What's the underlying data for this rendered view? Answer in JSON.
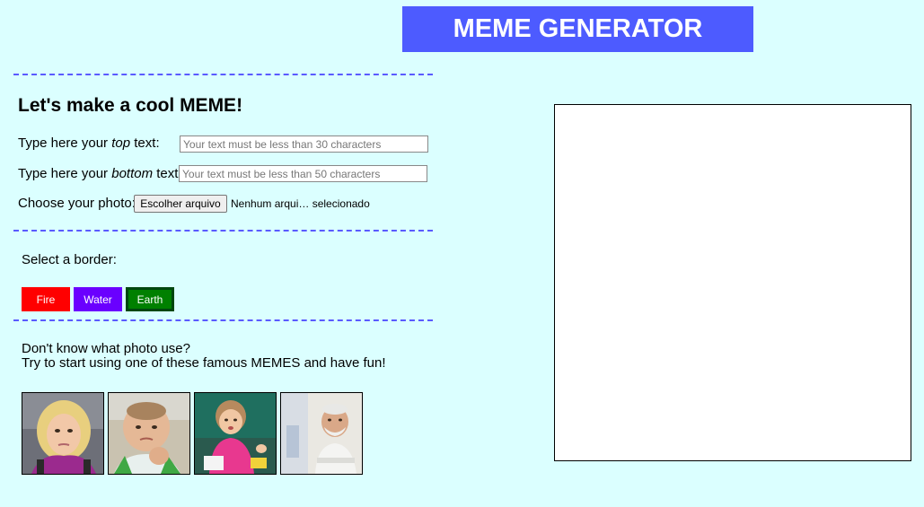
{
  "header": {
    "title": "MEME GENERATOR"
  },
  "form": {
    "heading": "Let's make a cool MEME!",
    "top_label_pre": "Type here your ",
    "top_label_em": "top",
    "top_label_post": " text:",
    "top_placeholder": "Your text must be less than 30 characters",
    "bottom_label_pre": "Type here your ",
    "bottom_label_em": "bottom",
    "bottom_label_post": " text:",
    "bottom_placeholder": "Your text must be less than 50 characters",
    "photo_label": "Choose your photo:",
    "file_button": "Escolher arquivo",
    "file_status": "Nenhum arqui… selecionado"
  },
  "borders": {
    "label": "Select a border:",
    "options": [
      {
        "label": "Fire",
        "color": "#ff0000"
      },
      {
        "label": "Water",
        "color": "#6a00ff"
      },
      {
        "label": "Earth",
        "color": "#008000"
      }
    ]
  },
  "suggestions": {
    "line1": "Don't know what photo use?",
    "line2": "Try to start using one of these famous MEMES and have fun!",
    "thumbnails": [
      "side-eyeing-chloe",
      "success-kid",
      "disaster-girl",
      "hide-the-pain-harold"
    ]
  },
  "colors": {
    "background": "#dbffff",
    "title_bar": "#4d5bff",
    "divider": "#5a5aff"
  }
}
